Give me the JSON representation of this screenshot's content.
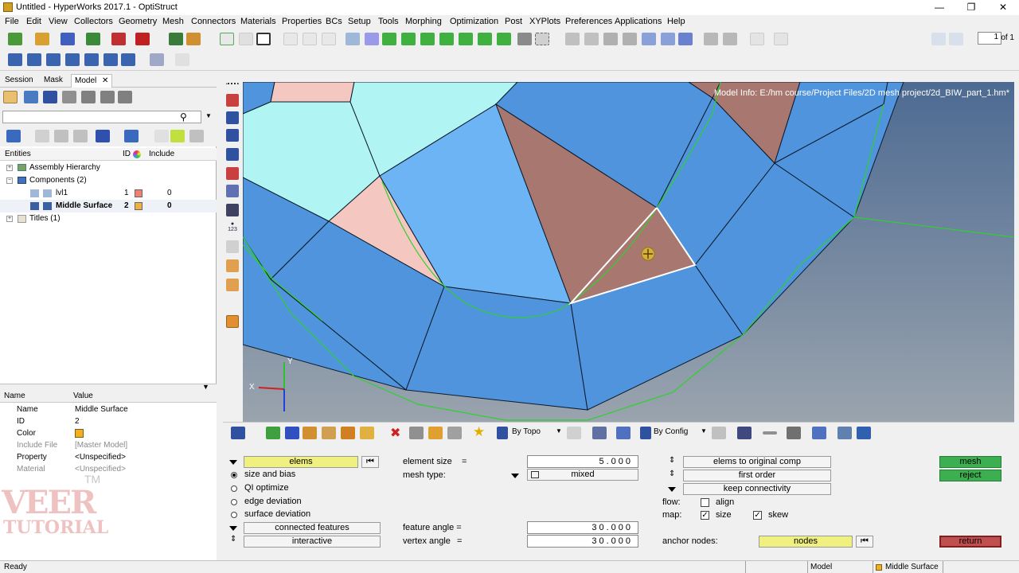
{
  "window": {
    "title": "Untitled - HyperWorks 2017.1 - OptiStruct",
    "minimize": "—",
    "restore": "❐",
    "close": "✕"
  },
  "menu": [
    "File",
    "Edit",
    "View",
    "Collectors",
    "Geometry",
    "Mesh",
    "Connectors",
    "Materials",
    "Properties",
    "BCs",
    "Setup",
    "Tools",
    "Morphing",
    "Optimization",
    "Post",
    "XYPlots",
    "Preferences",
    "Applications",
    "Help"
  ],
  "pager": {
    "page": "1",
    "of": "of 1"
  },
  "browser": {
    "tabs": [
      "Session",
      "Mask",
      "Model"
    ],
    "close_tab": "✕",
    "columns": {
      "entities": "Entities",
      "id": "ID",
      "include": "Include"
    },
    "tree": [
      {
        "label": "Assembly Hierarchy",
        "id": "",
        "include": ""
      },
      {
        "label": "Components (2)",
        "id": "",
        "include": ""
      },
      {
        "label": "lvl1",
        "id": "1",
        "include": "0",
        "color": "#f08070"
      },
      {
        "label": "Middle Surface",
        "id": "2",
        "include": "0",
        "color": "#f0b040"
      },
      {
        "label": "Titles (1)",
        "id": "",
        "include": ""
      }
    ]
  },
  "properties": {
    "columns": {
      "name": "Name",
      "value": "Value"
    },
    "rows": [
      {
        "name": "Name",
        "value": "Middle Surface"
      },
      {
        "name": "ID",
        "value": "2"
      },
      {
        "name": "Color",
        "value": ""
      },
      {
        "name": "Include File",
        "value": "[Master Model]"
      },
      {
        "name": "Property",
        "value": "<Unspecified>"
      },
      {
        "name": "Material",
        "value": "<Unspecified>"
      }
    ],
    "color_swatch": "#f0b020"
  },
  "watermark": {
    "line1": "VEER",
    "line2": "TUTORIAL",
    "tm": "TM"
  },
  "viewport": {
    "model_info": "Model Info: E:/hm course/Project Files/2D mesh project/2d_BIW_part_1.hm*",
    "axis_x": "X",
    "axis_y": "Y",
    "colors": {
      "blue": "#4f94dc",
      "light_blue": "#6cb4f4",
      "cyan": "#b0f4f4",
      "brown": "#a87870",
      "pink": "#f4c8c0",
      "edge_green": "#2fd02f"
    }
  },
  "vpbar": {
    "topo": "By Topo",
    "config": "By Config"
  },
  "panel": {
    "elems": "elems",
    "size_and_bias": "size and bias",
    "ql_optimize": "QI optimize",
    "edge_deviation": "edge deviation",
    "surface_deviation": "surface deviation",
    "connected_features": "connected features",
    "interactive": "interactive",
    "element_size_label": "element size",
    "equals": "=",
    "element_size": "5.000",
    "mesh_type_label": "mesh type:",
    "mesh_type": "mixed",
    "feature_angle_label": "feature angle =",
    "feature_angle": "30.000",
    "vertex_angle_label": "vertex angle",
    "vertex_angle": "30.000",
    "elems_to_original_comp": "elems to original comp",
    "first_order": "first order",
    "keep_connectivity": "keep connectivity",
    "flow_label": "flow:",
    "align": "align",
    "map_label": "map:",
    "size": "size",
    "skew": "skew",
    "anchor_nodes_label": "anchor nodes:",
    "nodes": "nodes",
    "mesh": "mesh",
    "reject": "reject",
    "return": "return"
  },
  "status": {
    "text": "Ready",
    "model": "Model",
    "component": "Middle Surface"
  }
}
